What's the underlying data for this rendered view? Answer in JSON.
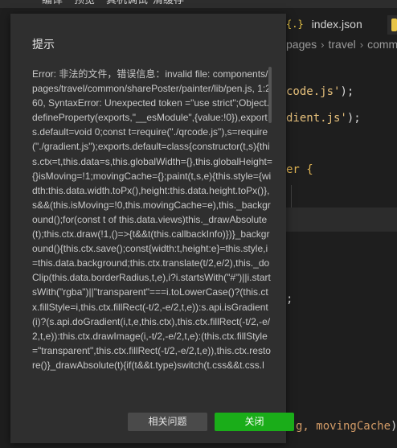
{
  "menubar": {
    "items": [
      "编译",
      "预览",
      "真机调试",
      "清缓存"
    ]
  },
  "editor": {
    "tab": {
      "badge": "{.}",
      "label": "index.json"
    },
    "breadcrumb": [
      "pages",
      "travel",
      "comm"
    ],
    "code_lines": [
      {
        "text": "code.js'",
        "tail": ");"
      },
      {
        "text": "dient.js'",
        "tail": ");"
      },
      {
        "text": "er {",
        "tail": ""
      },
      {
        "text": ";",
        "tail": ""
      },
      {
        "param": "g, movingCache",
        "tail": ")"
      }
    ]
  },
  "dialog": {
    "title": "提示",
    "message": "Error: 非法的文件，错误信息：invalid file: components/pages/travel/common/sharePoster/painter/lib/pen.js, 1:260, SyntaxError: Unexpected token =\"use strict\";Object.defineProperty(exports,\"__esModule\",{value:!0}),exports.default=void 0;const t=require(\"./qrcode.js\"),s=require(\"./gradient.js\");exports.default=class{constructor(t,s){this.ctx=t,this.data=s,this.globalWidth={},this.globalHeight={}isMoving=!1;movingCache={};paint(t,s,e){this.style={width:this.data.width.toPx(),height:this.data.height.toPx()},s&&(this.isMoving=!0,this.movingCache=e),this._background();for(const t of this.data.views)this._drawAbsolute(t);this.ctx.draw(!1,()=>{t&&t(this.callbackInfo)})}_background(){this.ctx.save();const{width:t,height:e}=this.style,i=this.data.background;this.ctx.translate(t/2,e/2),this._doClip(this.data.borderRadius,t,e),i?i.startsWith(\"#\")||i.startsWith(\"rgba\")||\"transparent\"===i.toLowerCase()?(this.ctx.fillStyle=i,this.ctx.fillRect(-t/2,-e/2,t,e)):s.api.isGradient(i)?(s.api.doGradient(i,t,e,this.ctx),this.ctx.fillRect(-t/2,-e/2,t,e)):this.ctx.drawImage(i,-t/2,-e/2,t,e):(this.ctx.fillStyle=\"transparent\",this.ctx.fillRect(-t/2,-e/2,t,e)),this.ctx.restore()}_drawAbsolute(t){if(t&&t.type)switch(t.css&&t.css.l",
    "buttons": {
      "related": "相关问题",
      "close": "关闭"
    }
  },
  "colors": {
    "primary_button": "#1aad19",
    "dialog_bg": "#2f2f2f",
    "editor_bg": "#1e1e1e",
    "string": "#e6c07b"
  }
}
